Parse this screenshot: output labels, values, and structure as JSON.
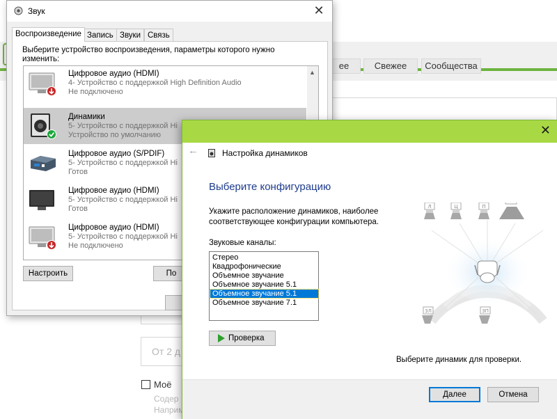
{
  "background": {
    "tabs": [
      "ее",
      "Свежее",
      "Сообщества"
    ],
    "date_input_text": "От 2 д",
    "checkbox_label": "Моё",
    "hint_line1": "Содер",
    "hint_line2": "Например, вы сделали эту фотографию"
  },
  "sound_dialog": {
    "title": "Звук",
    "close_glyph": "✕",
    "tabs": [
      "Воспроизведение",
      "Запись",
      "Звуки",
      "Связь"
    ],
    "active_tab": "Воспроизведение",
    "instruction": "Выберите устройство воспроизведения, параметры которого нужно изменить:",
    "devices": [
      {
        "name": "Цифровое аудио (HDMI)",
        "description": "4- Устройство с поддержкой High Definition Audio",
        "status": "Не подключено",
        "icon": "monitor-icon",
        "badge": "disconnected-badge-icon",
        "selected": false
      },
      {
        "name": "Динамики",
        "description": "5- Устройство с поддержкой Hi",
        "status": "Устройство по умолчанию",
        "icon": "speaker-icon",
        "badge": "default-check-badge-icon",
        "selected": true
      },
      {
        "name": "Цифровое аудио (S/PDIF)",
        "description": "5- Устройство с поддержкой Hi",
        "status": "Готов",
        "icon": "spdif-device-icon",
        "badge": "",
        "selected": false
      },
      {
        "name": "Цифровое аудио (HDMI)",
        "description": "5- Устройство с поддержкой Hi",
        "status": "Готов",
        "icon": "monitor-icon",
        "badge": "",
        "selected": false
      },
      {
        "name": "Цифровое аудио (HDMI)",
        "description": "5- Устройство с поддержкой Hi",
        "status": "Не подключено",
        "icon": "monitor-icon",
        "badge": "disconnected-badge-icon",
        "selected": false
      }
    ],
    "configure_button": "Настроить",
    "default_button_partial": "По"
  },
  "speaker_wizard": {
    "close_glyph": "✕",
    "back_glyph": "←",
    "title": "Настройка динамиков",
    "heading": "Выберите конфигурацию",
    "description": "Укажите расположение динамиков, наиболее соответствующее конфигурации компьютера.",
    "channels_label": "Звуковые каналы:",
    "channels": [
      "Стерео",
      "Квадрофонические",
      "Объемное звучание",
      "Объемное звучание 5.1",
      "Объемное звучание 5.1",
      "Объемное звучание 7.1"
    ],
    "selected_channel_index": 4,
    "test_button": "Проверка",
    "hint": "Выберите динамик для проверки.",
    "next_button": "Далее",
    "cancel_button": "Отмена",
    "speaker_labels": {
      "front_left": "Л",
      "center": "Ц",
      "front_right": "П",
      "subwoofer": "НЧ",
      "rear_left": "ЗЛ",
      "rear_right": "ЗП"
    },
    "colors": {
      "title_bar": "#a8d944",
      "heading": "#1e3c8c",
      "selection": "#0078d7"
    }
  }
}
